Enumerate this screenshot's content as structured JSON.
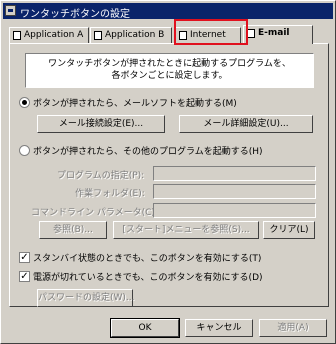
{
  "window": {
    "title": "ワンタッチボタンの設定"
  },
  "tabs": [
    {
      "label": "Application A",
      "icon": "application-icon"
    },
    {
      "label": "Application B",
      "icon": "application-icon"
    },
    {
      "label": "Internet",
      "icon": "internet-icon"
    },
    {
      "label": "E-mail",
      "icon": "email-icon"
    }
  ],
  "highlight_color": "#e0101e",
  "description": {
    "line1": "ワンタッチボタンが押されたときに起動するプログラムを、",
    "line2": "各ボタンごとに設定します。"
  },
  "radio_mail": {
    "label": "ボタンが押されたら、メールソフトを起動する(M)",
    "checked": true
  },
  "buttons_mail": {
    "connect": "メール接続設定(E)...",
    "detail": "メール詳細設定(U)..."
  },
  "radio_other": {
    "label": "ボタンが押されたら、その他のプログラムを起動する(H)",
    "checked": false
  },
  "program": {
    "name_label": "プログラムの指定(P):",
    "folder_label": "作業フォルダ(E):",
    "cmd_label": "コマンドライン パラメータ(C):",
    "browse": "参照(B)...",
    "start_menu": "[スタート]メニューを参照(S)...",
    "clear": "クリア(L)"
  },
  "options": {
    "standby": {
      "label": "スタンバイ状態のときでも、このボタンを有効にする(T)",
      "checked": true
    },
    "power_off": {
      "label": "電源が切れているときでも、このボタンを有効にする(D)",
      "checked": true
    },
    "password": "パスワードの設定(W)..."
  },
  "footer": {
    "ok": "OK",
    "cancel": "キャンセル",
    "apply": "適用(A)"
  }
}
